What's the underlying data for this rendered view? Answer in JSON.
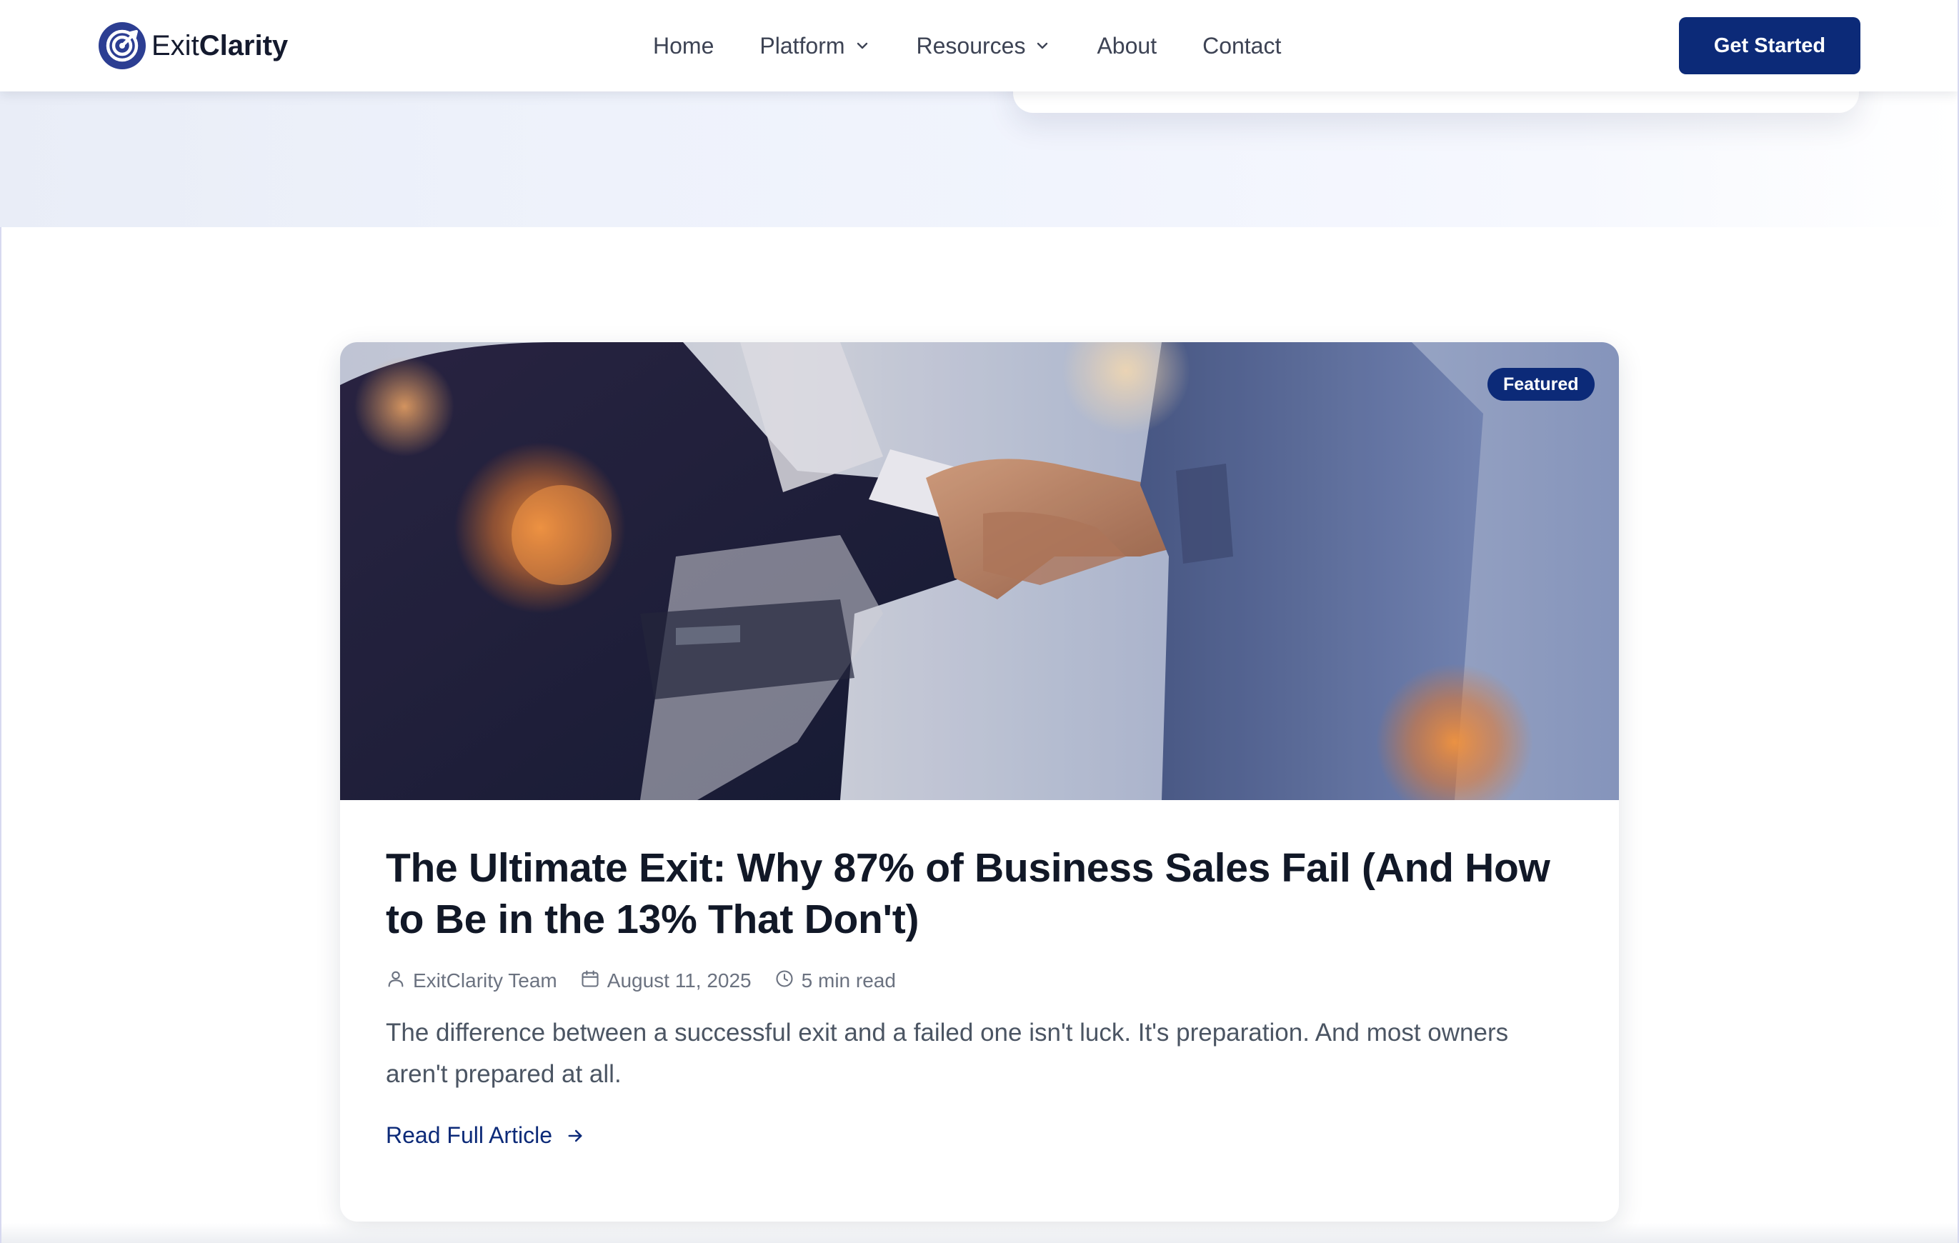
{
  "brand": {
    "name_light": "Exit",
    "name_bold": "Clarity",
    "color": "#0c2a78",
    "logo_icon": "target-icon"
  },
  "nav": {
    "items": [
      {
        "label": "Home",
        "has_dropdown": false
      },
      {
        "label": "Platform",
        "has_dropdown": true
      },
      {
        "label": "Resources",
        "has_dropdown": true
      },
      {
        "label": "About",
        "has_dropdown": false
      },
      {
        "label": "Contact",
        "has_dropdown": false
      }
    ],
    "cta_label": "Get Started"
  },
  "featured_post": {
    "badge": "Featured",
    "image_subject": "handshake-photo",
    "title": "The Ultimate Exit: Why 87% of Business Sales Fail (And How to Be in the 13% That Don't)",
    "author": "ExitClarity Team",
    "date": "August 11, 2025",
    "read_time": "5 min read",
    "excerpt": "The difference between a successful exit and a failed one isn't luck. It's preparation. And most owners aren't prepared at all.",
    "cta_label": "Read Full Article"
  },
  "colors": {
    "primary": "#0c2a78",
    "heading": "#111827",
    "muted": "#6b7280",
    "body": "#4b5563"
  }
}
